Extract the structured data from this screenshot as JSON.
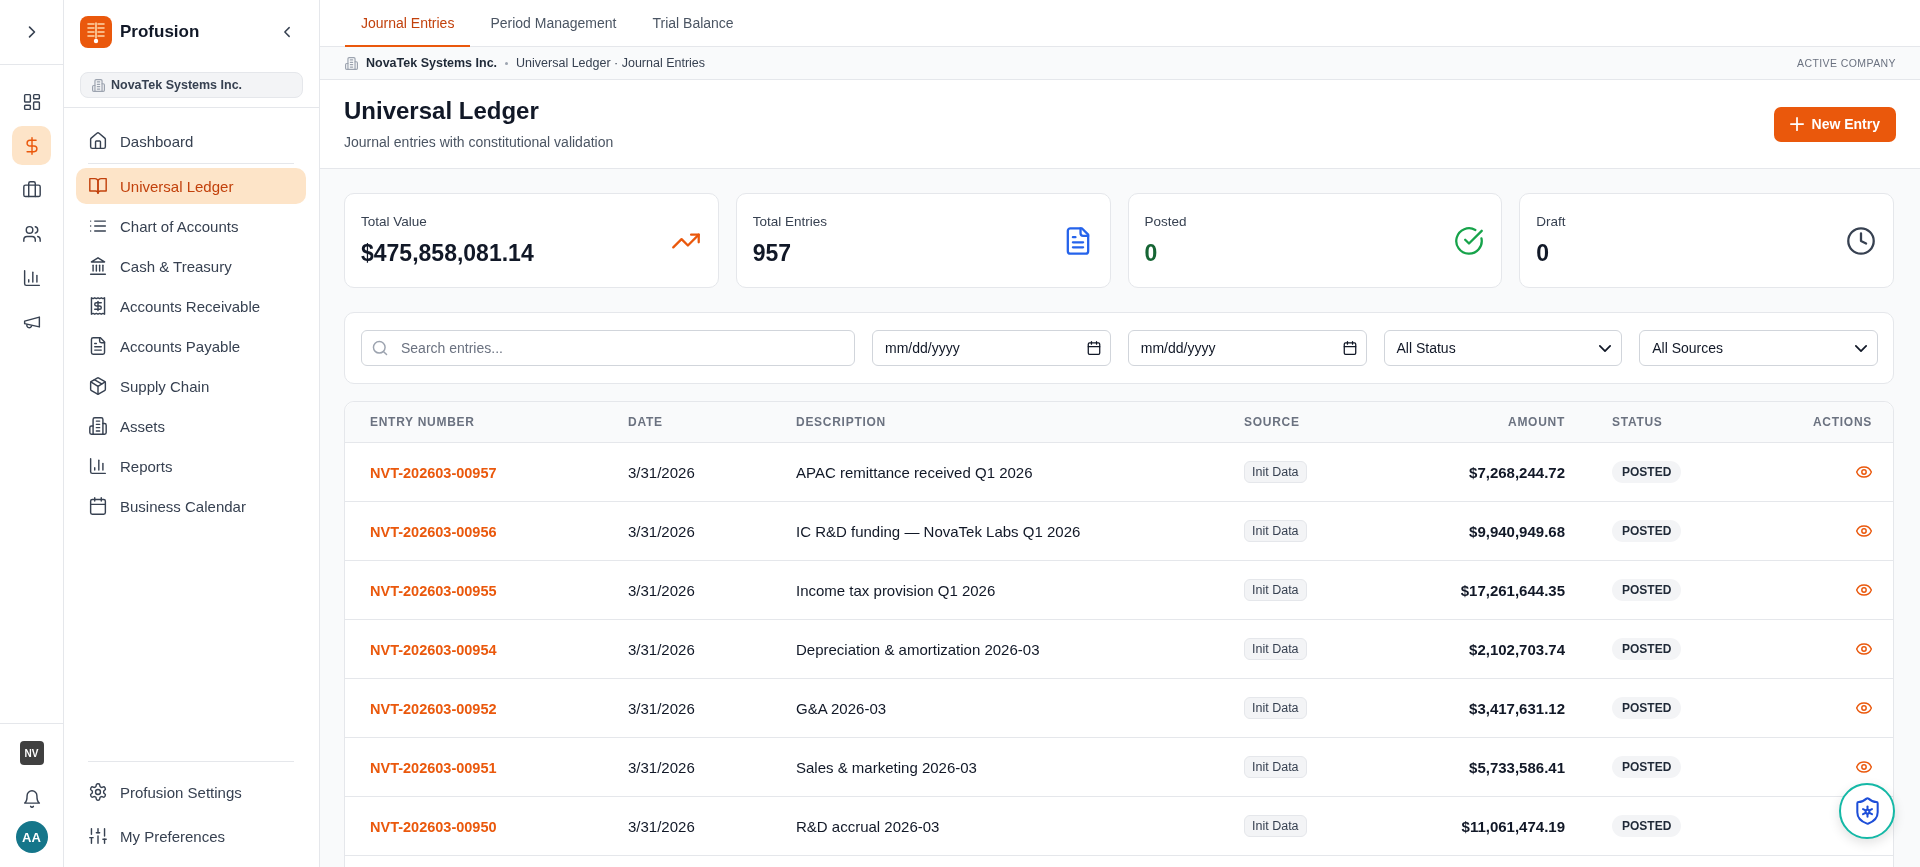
{
  "rail": {
    "items": [
      {
        "selected": false
      },
      {
        "selected": true
      },
      {
        "selected": false
      },
      {
        "selected": false
      },
      {
        "selected": false
      },
      {
        "selected": false
      }
    ],
    "company_badge": "NV",
    "avatar": "AA"
  },
  "sidebar": {
    "brand": "Profusion",
    "company": "NovaTek Systems Inc.",
    "sections": [
      {
        "items": [
          {
            "label": "Dashboard",
            "selected": false
          }
        ]
      },
      {
        "items": [
          {
            "label": "Universal Ledger",
            "selected": true
          },
          {
            "label": "Chart of Accounts",
            "selected": false
          },
          {
            "label": "Cash & Treasury",
            "selected": false
          },
          {
            "label": "Accounts Receivable",
            "selected": false
          },
          {
            "label": "Accounts Payable",
            "selected": false
          },
          {
            "label": "Supply Chain",
            "selected": false
          },
          {
            "label": "Assets",
            "selected": false
          },
          {
            "label": "Reports",
            "selected": false
          },
          {
            "label": "Business Calendar",
            "selected": false
          }
        ]
      }
    ],
    "footer_items": [
      "Profusion Settings",
      "My Preferences"
    ]
  },
  "tabs": [
    {
      "label": "Journal Entries",
      "selected": true
    },
    {
      "label": "Period Management",
      "selected": false
    },
    {
      "label": "Trial Balance",
      "selected": false
    }
  ],
  "breadcrumb": {
    "company": "NovaTek Systems Inc.",
    "path": "Universal Ledger · Journal Entries",
    "tag": "ACTIVE COMPANY"
  },
  "header": {
    "title": "Universal Ledger",
    "subtitle": "Journal entries with constitutional validation",
    "button": "New Entry"
  },
  "stats": [
    {
      "kind": "value",
      "label": "Total Value",
      "value": "$475,858,081.14"
    },
    {
      "kind": "entries",
      "label": "Total Entries",
      "value": "957"
    },
    {
      "kind": "posted",
      "label": "Posted",
      "value": "0"
    },
    {
      "kind": "draft",
      "label": "Draft",
      "value": "0"
    }
  ],
  "filters": {
    "search": {
      "placeholder": "Search entries..."
    },
    "date_from": {
      "placeholder": "mm/dd/yyyy"
    },
    "date_to": {
      "placeholder": "mm/dd/yyyy"
    },
    "status": {
      "value": "All Status"
    },
    "source": {
      "value": "All Sources"
    }
  },
  "table": {
    "columns": [
      "ENTRY NUMBER",
      "DATE",
      "DESCRIPTION",
      "SOURCE",
      "AMOUNT",
      "STATUS",
      "ACTIONS"
    ],
    "rows": [
      {
        "entry": "NVT-202603-00957",
        "date": "3/31/2026",
        "description": "APAC remittance received Q1 2026",
        "source": "Init Data",
        "amount": "$7,268,244.72",
        "status": "POSTED"
      },
      {
        "entry": "NVT-202603-00956",
        "date": "3/31/2026",
        "description": "IC R&D funding — NovaTek Labs Q1 2026",
        "source": "Init Data",
        "amount": "$9,940,949.68",
        "status": "POSTED"
      },
      {
        "entry": "NVT-202603-00955",
        "date": "3/31/2026",
        "description": "Income tax provision Q1 2026",
        "source": "Init Data",
        "amount": "$17,261,644.35",
        "status": "POSTED"
      },
      {
        "entry": "NVT-202603-00954",
        "date": "3/31/2026",
        "description": "Depreciation & amortization 2026-03",
        "source": "Init Data",
        "amount": "$2,102,703.74",
        "status": "POSTED"
      },
      {
        "entry": "NVT-202603-00952",
        "date": "3/31/2026",
        "description": "G&A 2026-03",
        "source": "Init Data",
        "amount": "$3,417,631.12",
        "status": "POSTED"
      },
      {
        "entry": "NVT-202603-00951",
        "date": "3/31/2026",
        "description": "Sales & marketing 2026-03",
        "source": "Init Data",
        "amount": "$5,733,586.41",
        "status": "POSTED"
      },
      {
        "entry": "NVT-202603-00950",
        "date": "3/31/2026",
        "description": "R&D accrual 2026-03",
        "source": "Init Data",
        "amount": "$11,061,474.19",
        "status": "POSTED"
      }
    ]
  }
}
